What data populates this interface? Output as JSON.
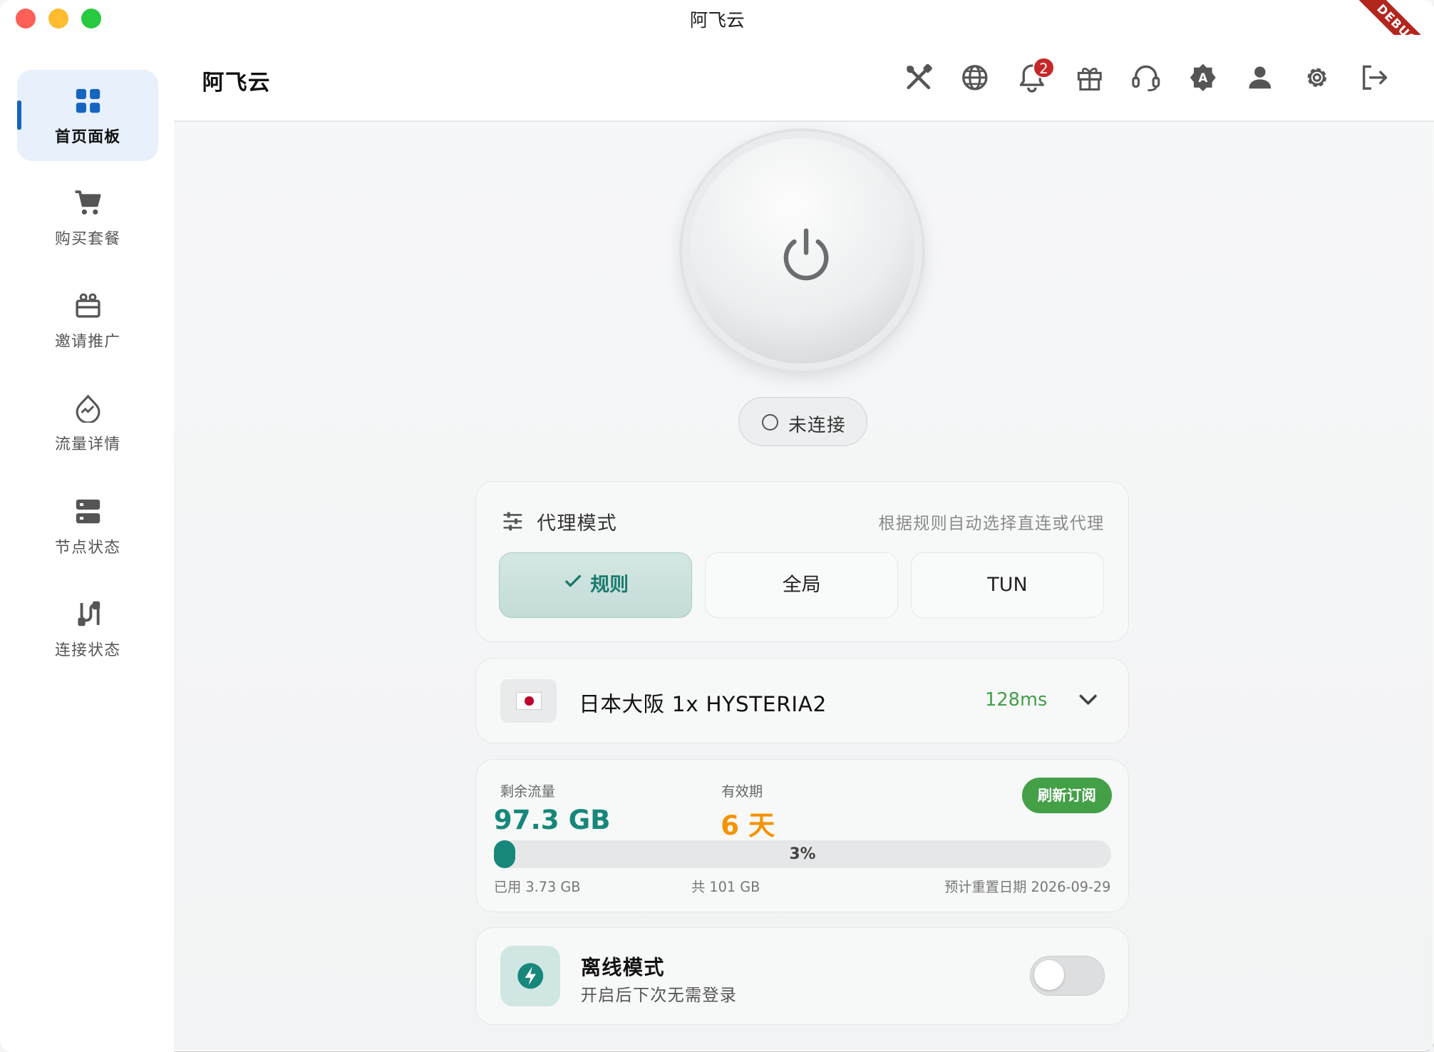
{
  "window": {
    "title": "阿飞云",
    "debug_banner": "DEBUG"
  },
  "sidebar": {
    "items": [
      {
        "label": "首页面板",
        "icon": "dashboard-icon",
        "active": true
      },
      {
        "label": "购买套餐",
        "icon": "cart-icon"
      },
      {
        "label": "邀请推广",
        "icon": "gift-box-icon"
      },
      {
        "label": "流量详情",
        "icon": "traffic-icon"
      },
      {
        "label": "节点状态",
        "icon": "server-icon"
      },
      {
        "label": "连接状态",
        "icon": "connection-icon"
      }
    ]
  },
  "header": {
    "title": "阿飞云",
    "notifications_count": "2",
    "tools": [
      "tools-icon",
      "globe-icon",
      "bell-icon",
      "gift-icon",
      "headset-icon",
      "translate-icon",
      "user-icon",
      "settings-icon",
      "logout-icon"
    ]
  },
  "power": {
    "status": "未连接"
  },
  "proxy_mode": {
    "title": "代理模式",
    "description": "根据规则自动选择直连或代理",
    "options": [
      "规则",
      "全局",
      "TUN"
    ],
    "selected": "规则"
  },
  "node": {
    "name": "日本大阪 1x HYSTERIA2",
    "latency": "128ms",
    "flag": "JP"
  },
  "traffic": {
    "remaining_label": "剩余流量",
    "remaining_value": "97.3 GB",
    "validity_label": "有效期",
    "validity_value": "6 天",
    "refresh_label": "刷新订阅",
    "percent_text": "3%",
    "used_fraction": 0.03,
    "used_text": "已用 3.73 GB",
    "total_text": "共 101 GB",
    "reset_text": "预计重置日期 2026-09-29"
  },
  "offline": {
    "title": "离线模式",
    "subtitle": "开启后下次无需登录",
    "enabled": false
  },
  "colors": {
    "accent": "#16877a",
    "green": "#43a047",
    "orange": "#f59300",
    "badge": "#c62828",
    "active_nav": "#e8f0fb",
    "nav_blue": "#1565c0"
  }
}
